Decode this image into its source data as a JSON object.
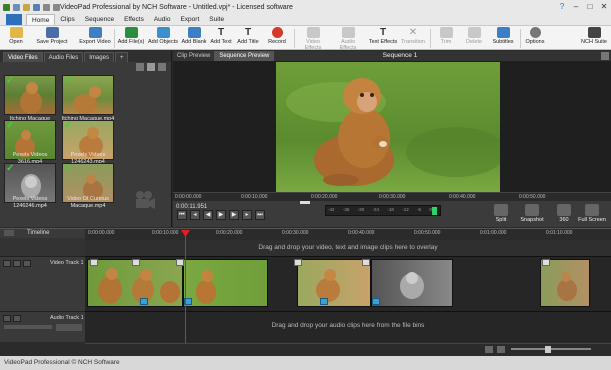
{
  "window": {
    "title": "VideoPad Professional by NCH Software - Untitled.vpj* - Licensed software",
    "min": "–",
    "max": "□",
    "close": "✕"
  },
  "menu": {
    "tabs": [
      "Home",
      "Clips",
      "Sequence",
      "Effects",
      "Audio",
      "Export",
      "Suite"
    ]
  },
  "ribbon": {
    "items": [
      "Open",
      "Save Project",
      "Export Video",
      "Add File(s)",
      "Add Objects",
      "Add Blank",
      "Add Text",
      "Add Title",
      "Record",
      "Video Effects",
      "Audio Effects",
      "Text Effects",
      "Transition",
      "Trim",
      "Delete",
      "Subtitles",
      "Options",
      "NCH Suite"
    ]
  },
  "bins": {
    "tabs": [
      "Video Files",
      "Audio Files",
      "Images"
    ],
    "add": "+",
    "clips": [
      "Itching Macaque (1).mp4",
      "Itching Macaque.mp4",
      "Pexels Videos 3616.mp4",
      "Pexels Videos 1246243.mp4",
      "Pexels Videos 1246246.mp4",
      "Video Of Curious Macaque.mp4"
    ]
  },
  "preview": {
    "tabs": [
      "Clip Preview",
      "Sequence Preview"
    ],
    "sequence_label": "Sequence 1",
    "ruler": [
      "0:00:00.000",
      "0:00:10.000",
      "0:00:20.000",
      "0:00:30.000",
      "0:00:40.000",
      "0:00:50.000"
    ],
    "time": "0:00:11.951",
    "meter": [
      "-42",
      "-36",
      "-30",
      "-24",
      "-18",
      "-12",
      "-6",
      "0"
    ]
  },
  "tools": {
    "split": "Split",
    "snapshot": "Snapshot",
    "vr": "360",
    "fullscreen": "Full Screen"
  },
  "timeline": {
    "label": "Timeline",
    "ruler": [
      "0:00:00.000",
      "0:00:10.000",
      "0:00:20.000",
      "0:00:30.000",
      "0:00:40.000",
      "0:00:50.000",
      "0:01:00.000",
      "0:01:10.000"
    ],
    "overlay_hint": "Drag and drop your video, text and image clips here to overlay",
    "video_track": "Video Track 1",
    "audio_track": "Audio Track 1",
    "audio_hint": "Drag and drop your audio clips here from the file bins"
  },
  "status": {
    "text": "VideoPad Professional © NCH Software"
  },
  "colors": {
    "accent": "#2d6fb8",
    "level": "#2ed46a",
    "playhead": "#e02020"
  }
}
